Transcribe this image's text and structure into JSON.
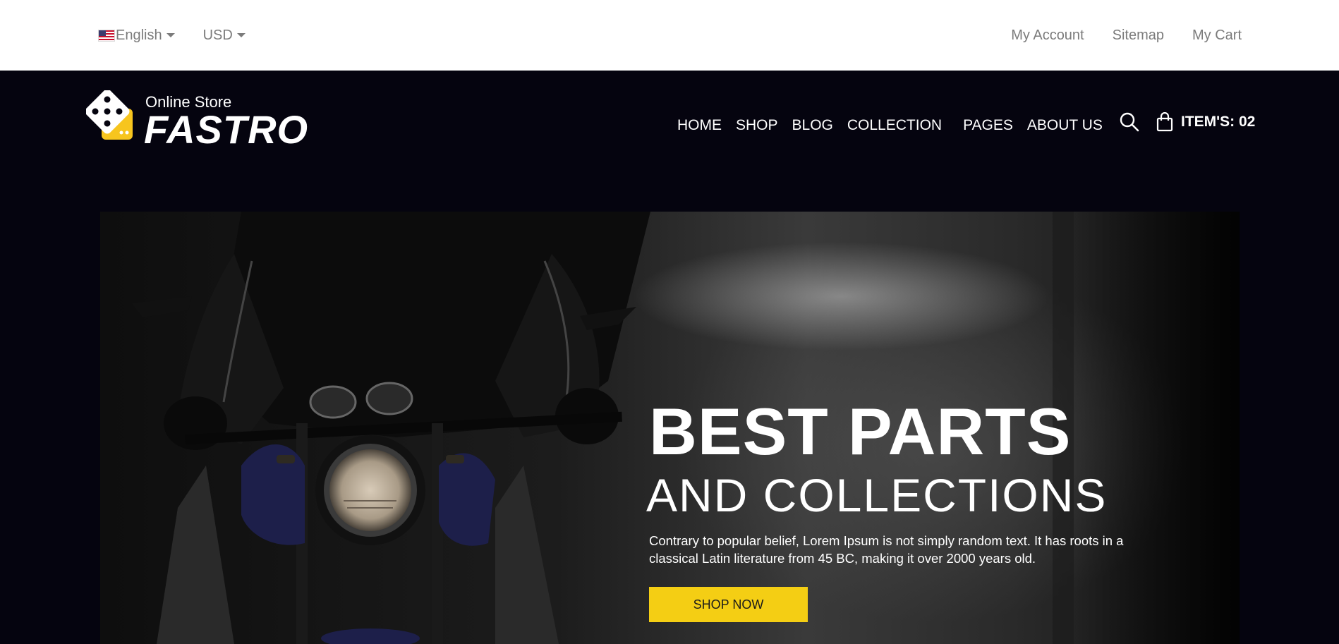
{
  "topbar": {
    "language": {
      "label": "English",
      "flag_icon": "us-flag-icon"
    },
    "currency": {
      "label": "USD"
    },
    "links": [
      "My Account",
      "Sitemap",
      "My Cart"
    ]
  },
  "header": {
    "logo": {
      "tagline": "Online Store",
      "brand": "FASTRO",
      "icon": "dice-icon"
    },
    "nav": [
      "HOME",
      "SHOP",
      "BLOG",
      "COLLECTION",
      "PAGES",
      "ABOUT US"
    ],
    "search_icon": "search-icon",
    "cart": {
      "icon": "shopping-bag-icon",
      "label": "ITEM'S: 02"
    }
  },
  "hero": {
    "title": "BEST PARTS",
    "subtitle": "AND COLLECTIONS",
    "description": "Contrary to popular belief, Lorem Ipsum is not simply random text. It has roots in a classical Latin literature from 45 BC, making it over 2000 years old.",
    "button": "SHOP NOW"
  },
  "colors": {
    "header_bg": "#05040f",
    "topbar_bg": "#ffffff",
    "topbar_text": "#7b7b7b",
    "accent": "#f4ce14",
    "logo_accent": "#f7c51e"
  }
}
